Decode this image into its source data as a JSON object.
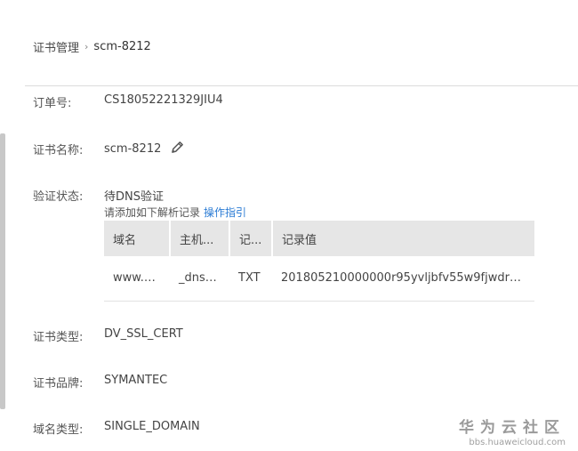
{
  "breadcrumb": {
    "parent": "证书管理",
    "separator": "›",
    "current": "scm-8212"
  },
  "fields": {
    "order_no": {
      "label": "订单号:",
      "value": "CS18052221329JIU4"
    },
    "cert_name": {
      "label": "证书名称:",
      "value": "scm-8212",
      "edit_icon": "pencil-icon"
    },
    "verify_status": {
      "label": "验证状态:",
      "value": "待DNS验证",
      "hint": "请添加如下解析记录",
      "hint_link": "操作指引"
    },
    "cert_type": {
      "label": "证书类型:",
      "value": "DV_SSL_CERT"
    },
    "cert_brand": {
      "label": "证书品牌:",
      "value": "SYMANTEC"
    },
    "domain_type": {
      "label": "域名类型:",
      "value": "SINGLE_DOMAIN"
    }
  },
  "dns_table": {
    "headers": [
      "域名",
      "主机...",
      "记...",
      "记录值"
    ],
    "rows": [
      [
        "www.h...",
        "_dnsa...",
        "TXT",
        "201805210000000r95yvljbfv55w9fjwdr5..."
      ]
    ]
  },
  "watermark": {
    "main": "华为云社区",
    "sub": "bbs.huaweicloud.com"
  },
  "colors": {
    "link": "#2a7bd4",
    "table_header_bg": "#e6e6e6",
    "divider": "#dcdcdc"
  }
}
